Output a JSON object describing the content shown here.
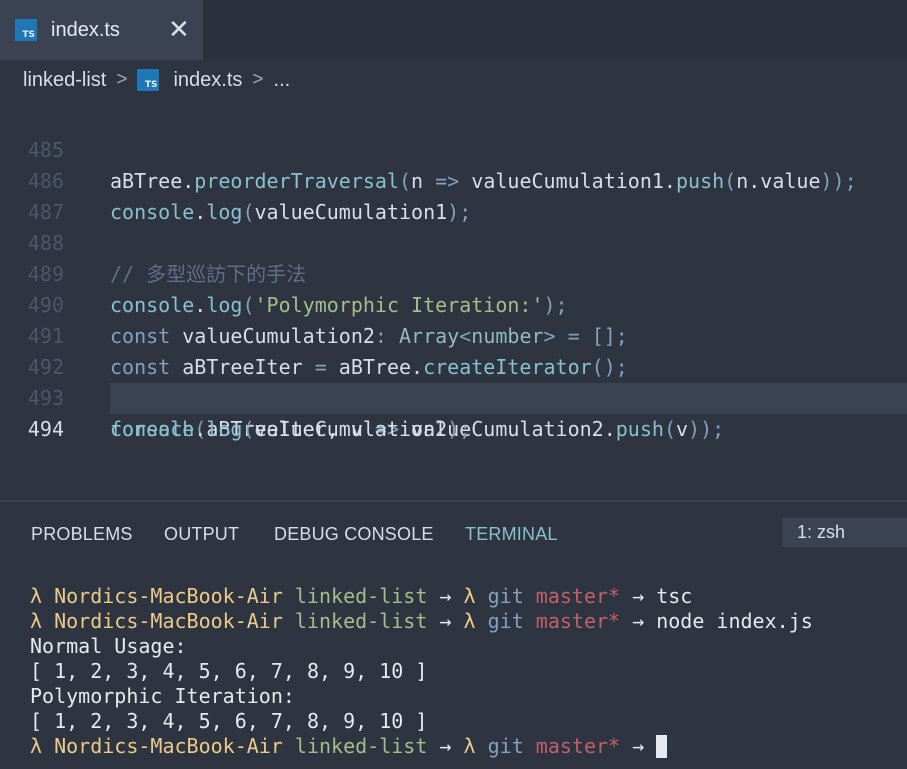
{
  "tab": {
    "icon": "typescript-file-icon",
    "icon_text": "TS",
    "label": "index.ts",
    "close_glyph": "✕"
  },
  "breadcrumb": {
    "folder": "linked-list",
    "sep": ">",
    "file": "index.ts",
    "more": "..."
  },
  "editor": {
    "active_line": 494,
    "lines": [
      {
        "num": "485",
        "code": "aBTree.preorderTraversal(n => valueCumulation1.push(n.value));"
      },
      {
        "num": "486",
        "code": "console.log(valueCumulation1);"
      },
      {
        "num": "487",
        "code": ""
      },
      {
        "num": "488",
        "code": "// 多型巡訪下的手法"
      },
      {
        "num": "489",
        "code": "console.log('Polymorphic Iteration:');"
      },
      {
        "num": "490",
        "code": "const valueCumulation2: Array<number> = [];"
      },
      {
        "num": "491",
        "code": "const aBTreeIter = aBTree.createIterator();"
      },
      {
        "num": "492",
        "code": ""
      },
      {
        "num": "493",
        "code": "foreach(aBTreeIter, v => valueCumulation2.push(v));"
      },
      {
        "num": "494",
        "code": "console.log(valueCumulation2);"
      }
    ]
  },
  "panel": {
    "tabs": [
      "PROBLEMS",
      "OUTPUT",
      "DEBUG CONSOLE",
      "TERMINAL"
    ],
    "active_tab": "TERMINAL",
    "terminal_select": "1: zsh"
  },
  "terminal": {
    "prompt": {
      "lambda": "λ",
      "host": "Nordics-MacBook-Air",
      "dir": "linked-list",
      "arrow": "→",
      "git": "git",
      "branch": "master*"
    },
    "commands": [
      "tsc",
      "node index.js",
      ""
    ],
    "output": [
      "Normal Usage:",
      "[ 1, 2, 3, 4, 5, 6, 7, 8, 9, 10 ]",
      "Polymorphic Iteration:",
      "[ 1, 2, 3, 4, 5, 6, 7, 8, 9, 10 ]"
    ]
  },
  "colors": {
    "background": "#2e3440",
    "accent": "#88c0d0",
    "keyword": "#81a1c1",
    "string": "#a3be8c",
    "branch": "#bf616a",
    "host": "#ebcb8b"
  }
}
